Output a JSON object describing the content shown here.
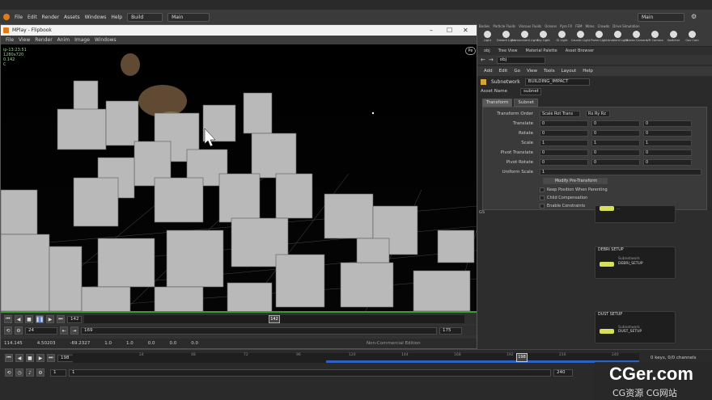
{
  "main_menu": {
    "items": [
      "File",
      "Edit",
      "Render",
      "Assets",
      "Windows",
      "Help"
    ],
    "desktop": "Build",
    "scene": "Main"
  },
  "top_right": {
    "desktop": "Main"
  },
  "mplay": {
    "title": "MPlay - Flipbook",
    "menu": [
      "File",
      "View",
      "Render",
      "Anim",
      "Image",
      "Windows"
    ],
    "viewport_info": [
      "ip-13:23:51",
      "1280x720",
      "0.142",
      "C"
    ],
    "frame": "142",
    "frame_marker": "142",
    "range_start": "24",
    "range_end": "175",
    "step_start": "169",
    "coords": [
      "114.145",
      "4.50203",
      "-69.2327",
      "1.0",
      "1.0",
      "0.0",
      "0.0",
      "0.0"
    ],
    "edition": "Non-Commercial Edition",
    "viewport_badge": "Pe"
  },
  "shelf": {
    "tabs": [
      "Bodies",
      "Particle Fluids",
      "Viscous Fluids",
      "Oceans",
      "Pyro FX",
      "FEM",
      "Wires",
      "Crowds",
      "Drive Simulation"
    ],
    "tools": [
      "Light",
      "Distant Light",
      "Environment Light",
      "Sky Light",
      "GI Light",
      "Caustic Light",
      "Portal Light",
      "Ambient Light",
      "Stereo Camera",
      "VR Camera",
      "Switcher",
      "Gas Cam"
    ]
  },
  "pane_tabs": [
    "obj",
    "Tree View",
    "Material Palette",
    "Asset Browser"
  ],
  "path": "obj",
  "pane_menu": [
    "Add",
    "Edit",
    "Go",
    "View",
    "Tools",
    "Layout",
    "Help"
  ],
  "param_header": {
    "type": "Subnetwork",
    "name": "BUILDING_IMPACT"
  },
  "asset": {
    "label": "Asset Name",
    "value": "subnet"
  },
  "param_tabs": [
    "Transform",
    "Subnet"
  ],
  "params": {
    "transform_order": {
      "label": "Transform Order",
      "a": "Scale Rot Trans",
      "b": "Rx Ry Rz"
    },
    "translate": {
      "label": "Translate",
      "values": [
        "0",
        "0",
        "0"
      ]
    },
    "rotate": {
      "label": "Rotate",
      "values": [
        "0",
        "0",
        "0"
      ]
    },
    "scale": {
      "label": "Scale",
      "values": [
        "1",
        "1",
        "1"
      ]
    },
    "pivot_translate": {
      "label": "Pivot Translate",
      "values": [
        "0",
        "0",
        "0"
      ]
    },
    "pivot_rotate": {
      "label": "Pivot Rotate",
      "values": [
        "0",
        "0",
        "0"
      ]
    },
    "uniform_scale": {
      "label": "Uniform Scale",
      "value": "1"
    },
    "modify_button": "Modify Pre-Transform",
    "checks": [
      "Keep Position When Parenting",
      "Child Compensation",
      "Enable Constraints"
    ]
  },
  "network": {
    "nodes": [
      {
        "title": "",
        "label": "...",
        "ref": "GS"
      },
      {
        "title": "DEBRI SETUP",
        "label": "DEBRI_SETUP",
        "sub": "Subnetwork"
      },
      {
        "title": "DUST SETUP",
        "label": "DUST_SETUP",
        "sub": "Subnetwork"
      }
    ]
  },
  "timeline": {
    "frame": "198",
    "current": "198",
    "ticks": [
      "24",
      "48",
      "72",
      "96",
      "120",
      "144",
      "168",
      "192",
      "216",
      "240"
    ],
    "start": "1",
    "start2": "1",
    "end": "240",
    "keys": "0 keys, 0/0 channels"
  },
  "watermark": {
    "big": "CGer.com",
    "small": "CG资源 CG网站"
  },
  "colors": {
    "accent_green": "#3f9a38",
    "node_yellow": "#d8e05a",
    "timeline_blue": "#2f62c9"
  }
}
